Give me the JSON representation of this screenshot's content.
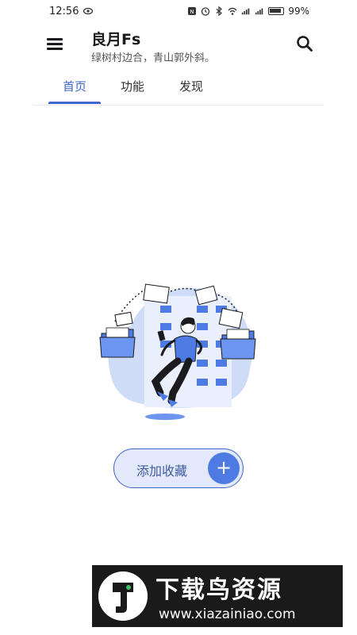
{
  "status_bar": {
    "time": "12:56",
    "battery": "99%"
  },
  "app_bar": {
    "title": "良月Fs",
    "subtitle": "绿树村边合，青山郭外斜。",
    "menu_icon": "menu-icon",
    "search_icon": "search-icon"
  },
  "tabs": [
    {
      "label": "首页",
      "active": true
    },
    {
      "label": "功能",
      "active": false
    },
    {
      "label": "发现",
      "active": false
    }
  ],
  "empty_state": {
    "illustration": "empty-folder-illustration"
  },
  "add_button": {
    "label": "添加收藏",
    "icon": "plus-icon"
  },
  "watermark": {
    "brand": "下载鸟资源",
    "url": "www.xiazainiao.com"
  },
  "colors": {
    "accent": "#3f66c8",
    "button_bg": "#e3e9fb",
    "fab": "#4e7be3"
  }
}
